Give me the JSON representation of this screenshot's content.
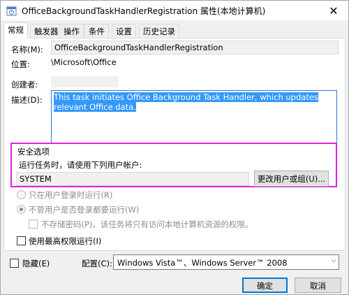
{
  "window": {
    "title": "OfficeBackgroundTaskHandlerRegistration 属性(本地计算机)",
    "close_glyph": "✕"
  },
  "tabs": [
    {
      "label": "常规",
      "active": true
    },
    {
      "label": "触发器"
    },
    {
      "label": "操作"
    },
    {
      "label": "条件"
    },
    {
      "label": "设置"
    },
    {
      "label": "历史记录"
    }
  ],
  "general": {
    "name_label": "名称(M):",
    "name_value": "OfficeBackgroundTaskHandlerRegistration",
    "location_label": "位置:",
    "location_value": "\\Microsoft\\Office",
    "author_label": "创建者:",
    "author_value": "",
    "description_label": "描述(D):",
    "description_value": "This task initiates Office Background Task Handler, which updates relevant Office data."
  },
  "security": {
    "group_title": "安全选项",
    "run_as_label": "运行任务时，请使用下列用户帐户:",
    "user_value": "SYSTEM",
    "change_user_button": "更改用户或组(U)...",
    "radio_logged_on": "只在用户登录时运行(R)",
    "radio_whether_logged": "不管用户是否登录都要运行(W)",
    "no_store_password": "不存储密码(P)。该任务将只有访问本地计算机资源的权限。",
    "highest_privileges": "使用最高权限运行(I)"
  },
  "footer": {
    "hidden_label": "隐藏(E)",
    "configure_label": "配置(C):",
    "configure_value": "Windows Vista™、Windows Server™ 2008",
    "ok_button": "确定",
    "cancel_button": "取消"
  },
  "colors": {
    "highlight_border": "#e020e0",
    "selection": "#3399ff",
    "accent": "#0078d7"
  }
}
